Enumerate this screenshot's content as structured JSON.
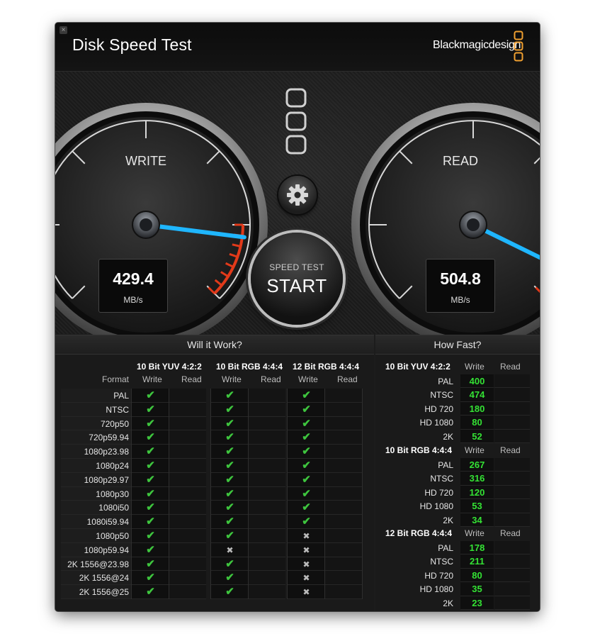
{
  "app": {
    "title": "Disk Speed Test",
    "brand": "Blackmagicdesign",
    "close_glyph": "×"
  },
  "gauges": {
    "write": {
      "label": "WRITE",
      "value": "429.4",
      "unit": "MB/s",
      "needle_fraction": 0.86
    },
    "read": {
      "label": "READ",
      "value": "504.8",
      "unit": "MB/s",
      "needle_fraction": 0.93
    }
  },
  "controls": {
    "start_small": "SPEED TEST",
    "start_big": "START",
    "settings_icon": "gear-icon"
  },
  "will_it_work": {
    "title": "Will it Work?",
    "format_header": "Format",
    "groups": [
      "10 Bit YUV 4:2:2",
      "10 Bit RGB 4:4:4",
      "12 Bit RGB 4:4:4"
    ],
    "col_write": "Write",
    "col_read": "Read",
    "check_glyph": "✔",
    "cross_glyph": "✖",
    "formats": [
      "PAL",
      "NTSC",
      "720p50",
      "720p59.94",
      "1080p23.98",
      "1080p24",
      "1080p29.97",
      "1080p30",
      "1080i50",
      "1080i59.94",
      "1080p50",
      "1080p59.94",
      "2K 1556@23.98",
      "2K 1556@24",
      "2K 1556@25"
    ],
    "results": [
      [
        "ok",
        "ok",
        "ok"
      ],
      [
        "ok",
        "ok",
        "ok"
      ],
      [
        "ok",
        "ok",
        "ok"
      ],
      [
        "ok",
        "ok",
        "ok"
      ],
      [
        "ok",
        "ok",
        "ok"
      ],
      [
        "ok",
        "ok",
        "ok"
      ],
      [
        "ok",
        "ok",
        "ok"
      ],
      [
        "ok",
        "ok",
        "ok"
      ],
      [
        "ok",
        "ok",
        "ok"
      ],
      [
        "ok",
        "ok",
        "ok"
      ],
      [
        "ok",
        "ok",
        "no"
      ],
      [
        "ok",
        "no",
        "no"
      ],
      [
        "ok",
        "ok",
        "no"
      ],
      [
        "ok",
        "ok",
        "no"
      ],
      [
        "ok",
        "ok",
        "no"
      ]
    ]
  },
  "how_fast": {
    "title": "How Fast?",
    "col_write": "Write",
    "col_read": "Read",
    "groups": [
      {
        "name": "10 Bit YUV 4:2:2",
        "rows": [
          [
            "PAL",
            "400"
          ],
          [
            "NTSC",
            "474"
          ],
          [
            "HD 720",
            "180"
          ],
          [
            "HD 1080",
            "80"
          ],
          [
            "2K",
            "52"
          ]
        ]
      },
      {
        "name": "10 Bit RGB 4:4:4",
        "rows": [
          [
            "PAL",
            "267"
          ],
          [
            "NTSC",
            "316"
          ],
          [
            "HD 720",
            "120"
          ],
          [
            "HD 1080",
            "53"
          ],
          [
            "2K",
            "34"
          ]
        ]
      },
      {
        "name": "12 Bit RGB 4:4:4",
        "rows": [
          [
            "PAL",
            "178"
          ],
          [
            "NTSC",
            "211"
          ],
          [
            "HD 720",
            "80"
          ],
          [
            "HD 1080",
            "35"
          ],
          [
            "2K",
            "23"
          ]
        ]
      }
    ]
  },
  "colors": {
    "needle": "#1fb6ff",
    "redzone": "#e23a1a",
    "check": "#3ec43e",
    "speed": "#34e234",
    "logo": "#f0a030"
  }
}
